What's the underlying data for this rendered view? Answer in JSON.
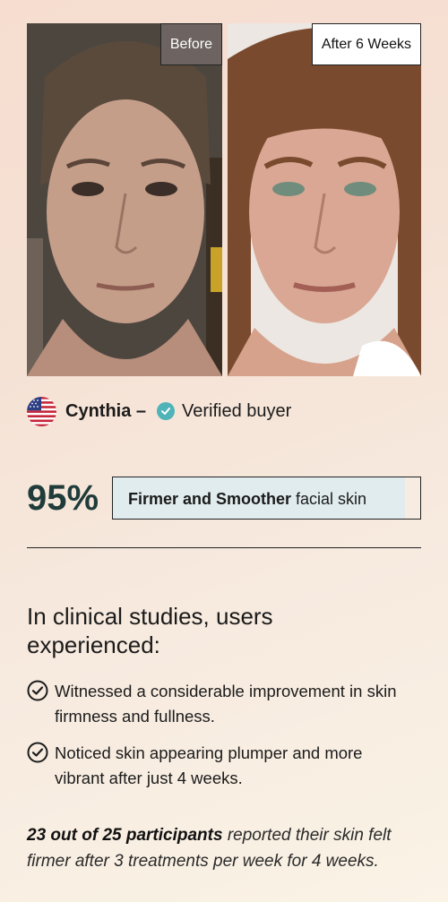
{
  "before_after": {
    "before_label": "Before",
    "after_label": "After 6 Weeks"
  },
  "reviewer": {
    "flag": "us-flag-icon",
    "name": "Cynthia –",
    "verified_label": "Verified buyer",
    "verified_color": "#4fb3b8"
  },
  "stat": {
    "percent_label": "95%",
    "percent_value": 95,
    "bold_text": "Firmer and Smoother",
    "text": " facial skin",
    "accent_color": "#1f3b3a",
    "fill_color": "#e1ecee"
  },
  "clinical": {
    "heading": "In clinical studies, users experienced:",
    "items": [
      "Witnessed a considerable improvement in skin firmness and fullness.",
      "Noticed skin appearing plumper and more vibrant after just 4 weeks."
    ]
  },
  "footnote": {
    "bold": "23 out of 25 participants",
    "text": " reported their skin felt firmer after 3 treatments per week for 4 weeks."
  }
}
